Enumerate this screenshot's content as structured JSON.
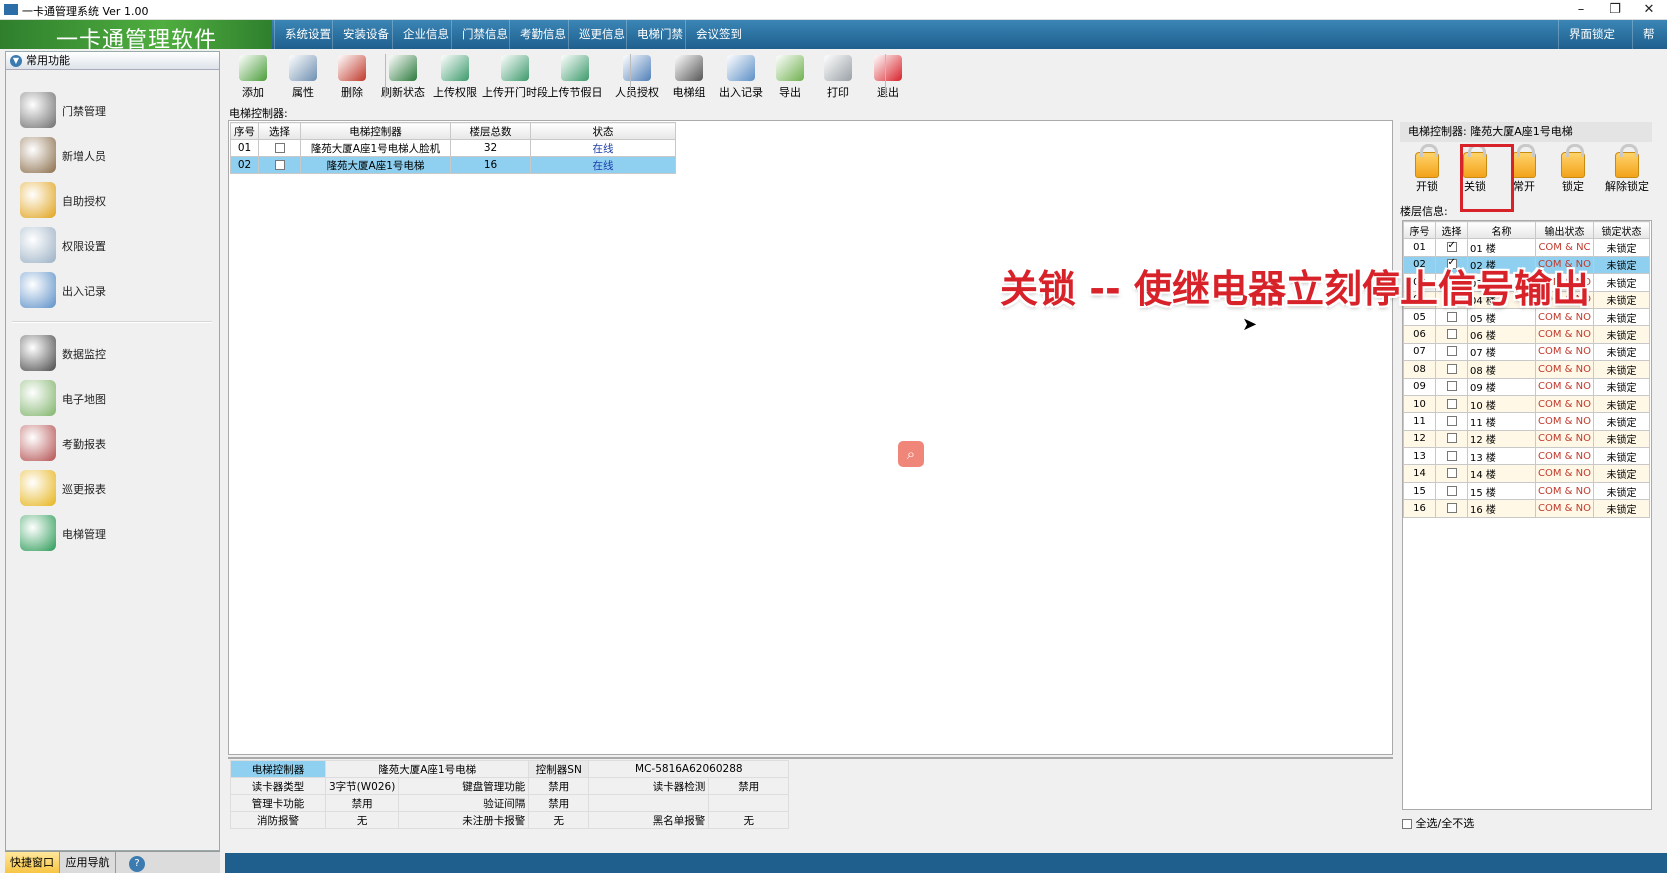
{
  "window": {
    "title": "一卡通管理系统  Ver 1.00",
    "controls": [
      "–",
      "❐",
      "✕"
    ]
  },
  "brand": "一卡通管理软件",
  "menu": [
    "系统设置",
    "安装设备",
    "企业信息",
    "门禁信息",
    "考勤信息",
    "巡更信息",
    "电梯门禁",
    "会议签到"
  ],
  "menu_right": [
    "界面锁定",
    "帮助"
  ],
  "sidebar": {
    "header": "常用功能",
    "items": [
      {
        "label": "门禁管理",
        "icon": "door-access-icon",
        "color": "#6d6d6d"
      },
      {
        "label": "新增人员",
        "icon": "person-icon",
        "color": "#8a6d4a"
      },
      {
        "label": "自助授权",
        "icon": "card-icon",
        "color": "#e0a21a"
      },
      {
        "label": "权限设置",
        "icon": "settings-doc-icon",
        "color": "#9ab0c4"
      },
      {
        "label": "出入记录",
        "icon": "magnifier-icon",
        "color": "#5b8fc7"
      }
    ],
    "items2": [
      {
        "label": "数据监控",
        "icon": "camera-icon",
        "color": "#4a4a4a"
      },
      {
        "label": "电子地图",
        "icon": "map-icon",
        "color": "#7fb36a"
      },
      {
        "label": "考勤报表",
        "icon": "clock-icon",
        "color": "#b45050"
      },
      {
        "label": "巡更报表",
        "icon": "patrol-icon",
        "color": "#e6b319"
      },
      {
        "label": "电梯管理",
        "icon": "elevator-icon",
        "color": "#2a9a55"
      }
    ],
    "bottom_tabs": [
      "快捷窗口",
      "应用导航",
      "?"
    ]
  },
  "toolbar": [
    {
      "label": "添加",
      "icon": "add-icon",
      "color": "#4a9d3a"
    },
    {
      "label": "属性",
      "icon": "properties-icon",
      "color": "#6e8fb0"
    },
    {
      "label": "删除",
      "icon": "delete-icon",
      "color": "#c0392b"
    },
    {
      "label": "刷新状态",
      "icon": "refresh-icon",
      "color": "#2c7a3c"
    },
    {
      "label": "上传权限",
      "icon": "upload-icon",
      "color": "#3c9a6c"
    },
    {
      "label": "上传开门时段",
      "icon": "upload-time-icon",
      "color": "#3c9a6c"
    },
    {
      "label": "上传节假日",
      "icon": "upload-holiday-icon",
      "color": "#3c9a6c"
    },
    {
      "label": "人员授权",
      "icon": "person-auth-icon",
      "color": "#4f7fb8"
    },
    {
      "label": "电梯组",
      "icon": "elevator-group-icon",
      "color": "#555"
    },
    {
      "label": "出入记录",
      "icon": "record-search-icon",
      "color": "#5b8fc7"
    },
    {
      "label": "导出",
      "icon": "export-icon",
      "color": "#6fb04e"
    },
    {
      "label": "打印",
      "icon": "print-icon",
      "color": "#9aa0a6"
    },
    {
      "label": "退出",
      "icon": "power-icon",
      "color": "#d8222a"
    }
  ],
  "controllers": {
    "section_label": "电梯控制器:",
    "headers": [
      "序号",
      "选择",
      "电梯控制器",
      "楼层总数",
      "状态"
    ],
    "rows": [
      {
        "no": "01",
        "name": "隆苑大厦A座1号电梯人脸机",
        "floors": "32",
        "status": "在线",
        "selected": false
      },
      {
        "no": "02",
        "name": "隆苑大厦A座1号电梯",
        "floors": "16",
        "status": "在线",
        "selected": true
      }
    ]
  },
  "info": {
    "ctrl_label": "电梯控制器",
    "ctrl_value": "隆苑大厦A座1号电梯",
    "sn_label": "控制器SN",
    "sn_value": "MC-5816A62060288",
    "reader_type_label": "读卡器类型",
    "reader_type_value": "3字节(W026)",
    "keypad_label": "键盘管理功能",
    "keypad_value": "禁用",
    "reader_detect_label": "读卡器检测",
    "reader_detect_value": "禁用",
    "admin_card_label": "管理卡功能",
    "admin_card_value": "禁用",
    "verify_label": "验证间隔",
    "verify_value": "禁用",
    "fire_label": "消防报警",
    "fire_value": "无",
    "unreg_label": "未注册卡报警",
    "unreg_value": "无",
    "blacklist_label": "黑名单报警",
    "blacklist_value": "无"
  },
  "right": {
    "title": "电梯控制器:  隆苑大厦A座1号电梯",
    "lock_buttons": [
      "开锁",
      "关锁",
      "常开",
      "锁定",
      "解除锁定"
    ],
    "floor_label": "楼层信息:",
    "floor_headers": [
      "序号",
      "选择",
      "名称",
      "输出状态",
      "锁定状态"
    ],
    "floors": [
      {
        "no": "01",
        "name": "01 楼",
        "out": "COM & NC",
        "lock": "未锁定",
        "checked": true
      },
      {
        "no": "02",
        "name": "02 楼",
        "out": "COM & NO",
        "lock": "未锁定",
        "checked": true
      },
      {
        "no": "03",
        "name": "03 楼",
        "out": "COM & NO",
        "lock": "未锁定",
        "checked": false
      },
      {
        "no": "04",
        "name": "04 楼",
        "out": "COM & NO",
        "lock": "未锁定",
        "checked": false
      },
      {
        "no": "05",
        "name": "05 楼",
        "out": "COM & NO",
        "lock": "未锁定",
        "checked": false
      },
      {
        "no": "06",
        "name": "06 楼",
        "out": "COM & NO",
        "lock": "未锁定",
        "checked": false
      },
      {
        "no": "07",
        "name": "07 楼",
        "out": "COM & NO",
        "lock": "未锁定",
        "checked": false
      },
      {
        "no": "08",
        "name": "08 楼",
        "out": "COM & NO",
        "lock": "未锁定",
        "checked": false
      },
      {
        "no": "09",
        "name": "09 楼",
        "out": "COM & NO",
        "lock": "未锁定",
        "checked": false
      },
      {
        "no": "10",
        "name": "10 楼",
        "out": "COM & NO",
        "lock": "未锁定",
        "checked": false
      },
      {
        "no": "11",
        "name": "11 楼",
        "out": "COM & NO",
        "lock": "未锁定",
        "checked": false
      },
      {
        "no": "12",
        "name": "12 楼",
        "out": "COM & NO",
        "lock": "未锁定",
        "checked": false
      },
      {
        "no": "13",
        "name": "13 楼",
        "out": "COM & NO",
        "lock": "未锁定",
        "checked": false
      },
      {
        "no": "14",
        "name": "14 楼",
        "out": "COM & NO",
        "lock": "未锁定",
        "checked": false
      },
      {
        "no": "15",
        "name": "15 楼",
        "out": "COM & NO",
        "lock": "未锁定",
        "checked": false
      },
      {
        "no": "16",
        "name": "16 楼",
        "out": "COM & NO",
        "lock": "未锁定",
        "checked": false
      }
    ],
    "select_all": "全选/全不选"
  },
  "annotation": "关锁 -- 使继电器立刻停止信号输出",
  "zoom_icon": "search-icon"
}
